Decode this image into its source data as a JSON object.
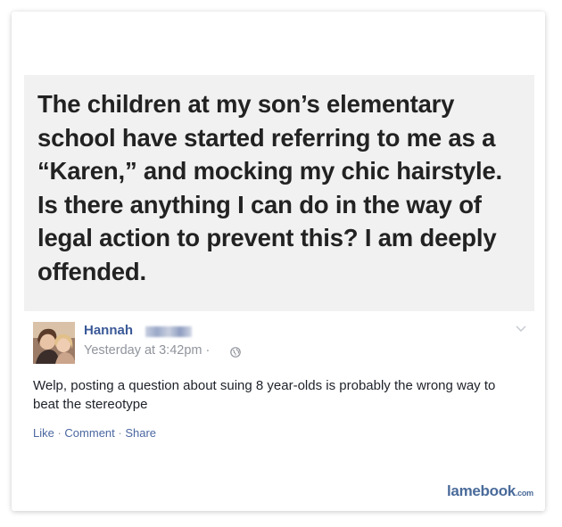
{
  "post": {
    "quote_text": "The children at my son’s elementary school have started referring to me as a “Karen,” and mocking my chic hairstyle. Is there anything I can do in the way of legal action to prevent this? I am deeply offended."
  },
  "comment": {
    "author_name": "Hannah",
    "timestamp": "Yesterday at 3:42pm ·",
    "text": "Welp, posting a question about suing 8 year-olds is probably the wrong way to beat the stereotype",
    "actions": {
      "like": "Like",
      "comment": "Comment",
      "share": "Share",
      "separator": " · "
    }
  },
  "watermark": {
    "brand": "lamebook",
    "tld": ".com"
  },
  "colors": {
    "link_blue": "#3b5998",
    "action_blue": "#4b67a1",
    "meta_gray": "#90949c",
    "quote_bg": "#f1f1f1",
    "quote_text": "#222222"
  },
  "icons": {
    "privacy": "globe-icon",
    "menu": "chevron-down-icon",
    "profile": "avatar"
  }
}
